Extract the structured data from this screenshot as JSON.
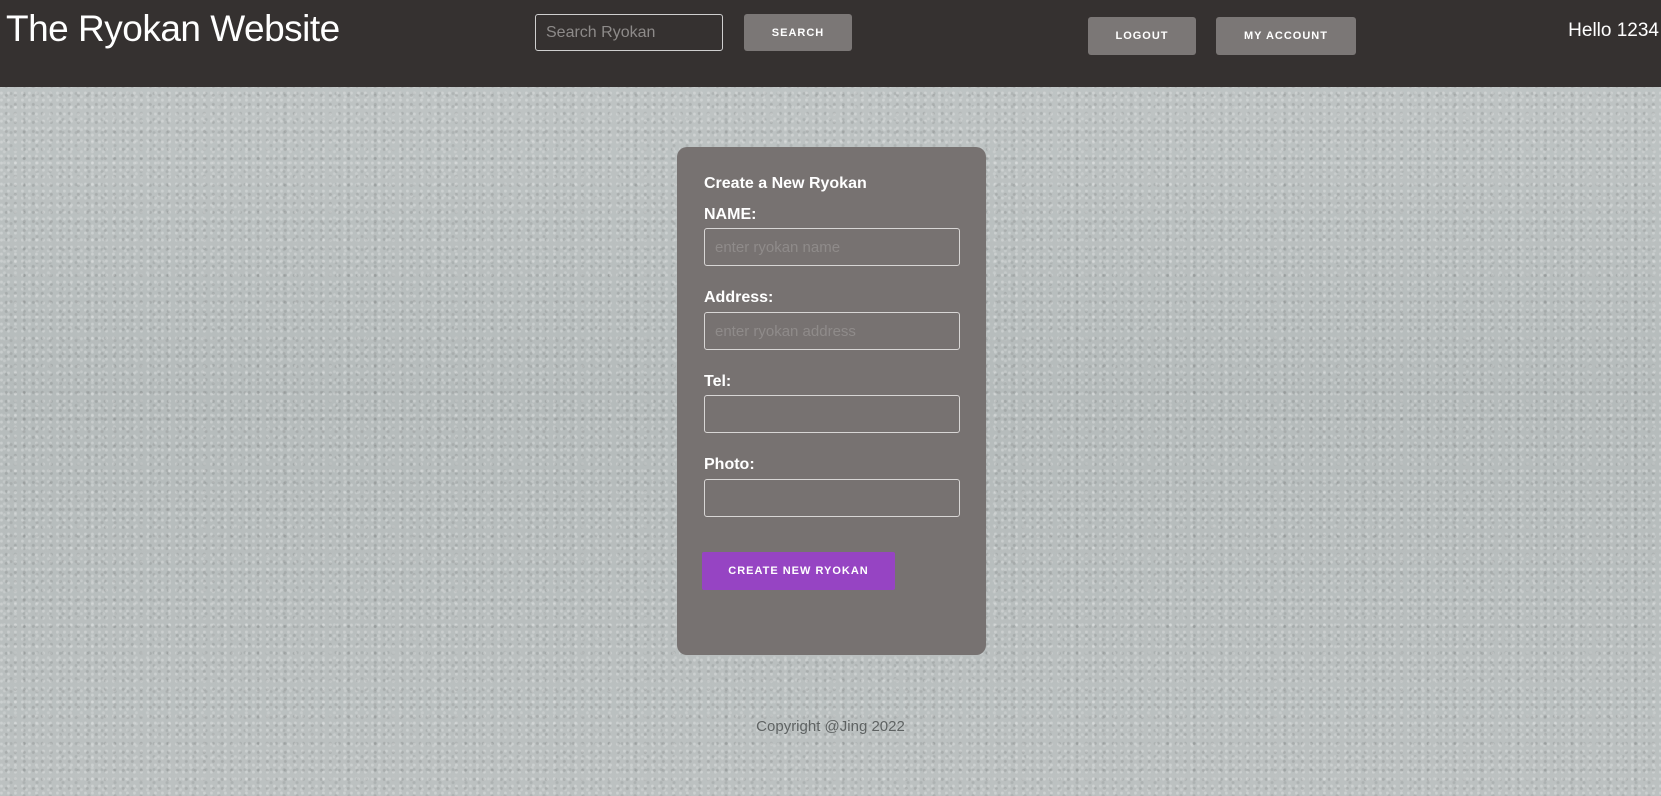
{
  "header": {
    "site_title": "The Ryokan Website",
    "search_placeholder": "Search Ryokan",
    "search_button": "SEARCH",
    "logout_button": "LOGOUT",
    "account_button": "MY ACCOUNT",
    "greeting": "Hello 1234"
  },
  "form": {
    "title": "Create a New Ryokan",
    "fields": [
      {
        "label": "NAME:",
        "placeholder": "enter ryokan name"
      },
      {
        "label": "Address:",
        "placeholder": "enter ryokan address"
      },
      {
        "label": "Tel:",
        "placeholder": ""
      },
      {
        "label": "Photo:",
        "placeholder": ""
      }
    ],
    "submit_button": "CREATE NEW RYOKAN"
  },
  "footer": {
    "copyright": "Copyright @Jing 2022"
  },
  "colors": {
    "header_bg": "#353130",
    "card_bg": "#777271",
    "button_gray": "#7b7776",
    "accent_purple": "#9644c3"
  }
}
